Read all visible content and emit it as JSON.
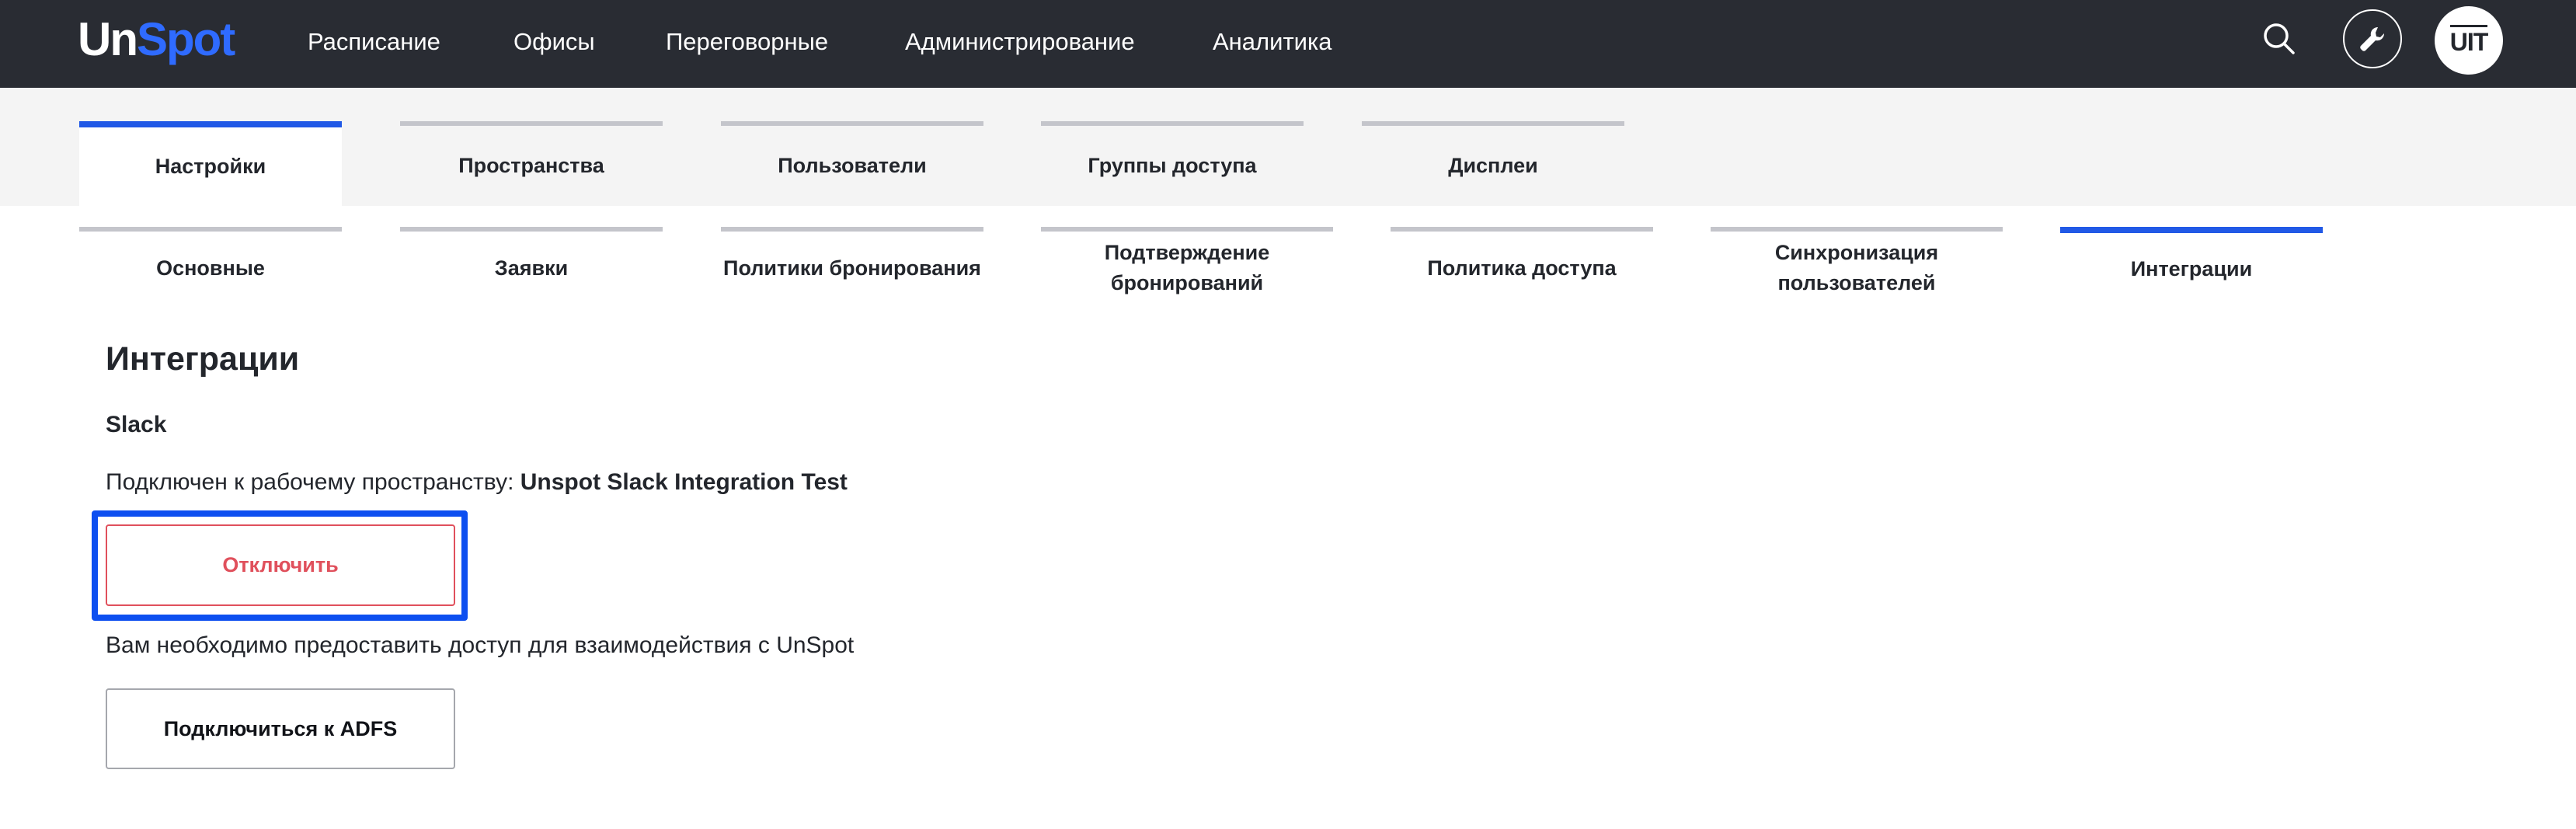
{
  "header": {
    "logo": {
      "part1": "Un",
      "part2": "Spot"
    },
    "nav": [
      {
        "label": "Расписание"
      },
      {
        "label": "Офисы"
      },
      {
        "label": "Переговорные"
      },
      {
        "label": "Администрирование"
      },
      {
        "label": "Аналитика"
      }
    ],
    "search_icon": "search-icon",
    "tools_icon": "wrench-icon",
    "avatar_initials": "UIT"
  },
  "tabs": [
    {
      "label": "Настройки",
      "active": true
    },
    {
      "label": "Пространства",
      "active": false
    },
    {
      "label": "Пользователи",
      "active": false
    },
    {
      "label": "Группы доступа",
      "active": false
    },
    {
      "label": "Дисплеи",
      "active": false
    }
  ],
  "subtabs": [
    {
      "line1": "Основные",
      "line2": "",
      "active": false
    },
    {
      "line1": "Заявки",
      "line2": "",
      "active": false
    },
    {
      "line1": "Политики бронирования",
      "line2": "",
      "active": false
    },
    {
      "line1": "Подтверждение",
      "line2": "бронирований",
      "active": false
    },
    {
      "line1": "Политика доступа",
      "line2": "",
      "active": false
    },
    {
      "line1": "Синхронизация",
      "line2": "пользователей",
      "active": false
    },
    {
      "line1": "Интеграции",
      "line2": "",
      "active": true
    }
  ],
  "content": {
    "title": "Интеграции",
    "slack": {
      "title": "Slack",
      "connected_prefix": "Подключен к рабочему пространству: ",
      "workspace_name": "Unspot Slack Integration Test",
      "disconnect_label": "Отключить"
    },
    "adfs": {
      "note": "Вам необходимо предоставить доступ для взаимодействия с UnSpot",
      "connect_label": "Подключиться к ADFS"
    }
  },
  "colors": {
    "topbar": "#292c33",
    "brand_blue": "#2f6bff",
    "active_tab": "#2159e6",
    "danger": "#e0505c",
    "highlight": "#0d4ff0"
  }
}
